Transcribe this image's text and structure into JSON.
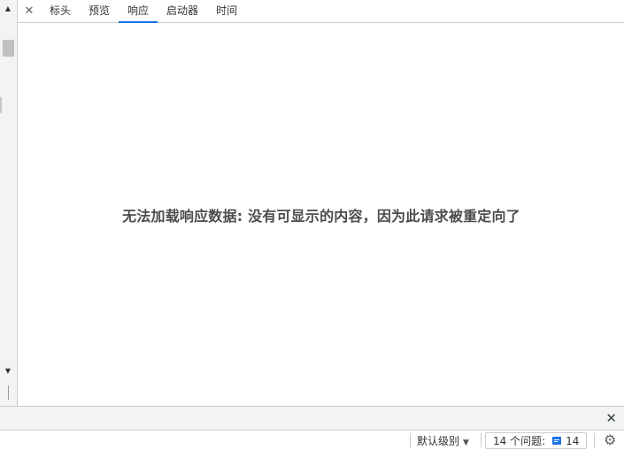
{
  "tabs": [
    {
      "label": "标头",
      "active": false
    },
    {
      "label": "预览",
      "active": false
    },
    {
      "label": "响应",
      "active": true
    },
    {
      "label": "启动器",
      "active": false
    },
    {
      "label": "时间",
      "active": false
    }
  ],
  "close_tab_glyph": "✕",
  "message": "无法加载响应数据: 没有可显示的内容，因为此请求被重定向了",
  "drawer": {
    "close_glyph": "✕"
  },
  "console": {
    "level_label": "默认级别",
    "level_arrow": "▼",
    "issues_label": "14 个问题:",
    "issues_count": "14",
    "settings_glyph": "⚙"
  },
  "scrollbar": {
    "up_glyph": "▲",
    "down_glyph": "▼"
  },
  "colors": {
    "accent": "#1a73e8",
    "message_text": "#4d4d4d",
    "border": "#cbcdd1"
  }
}
